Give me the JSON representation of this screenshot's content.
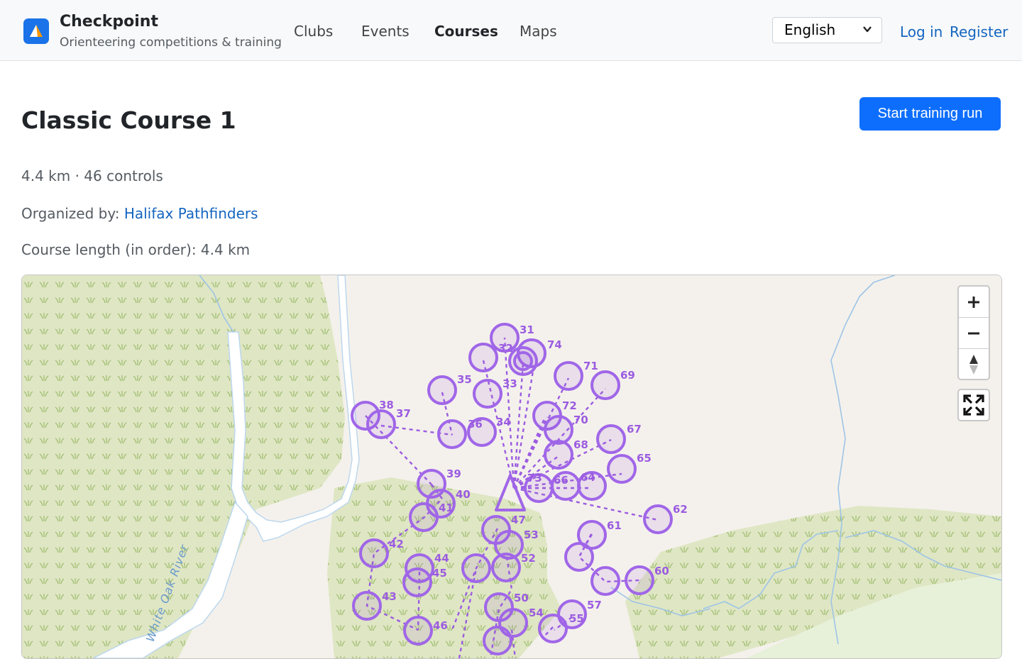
{
  "brand": {
    "name": "Checkpoint",
    "tagline": "Orienteering competitions & training"
  },
  "nav": {
    "items": [
      "Clubs",
      "Events",
      "Courses",
      "Maps"
    ],
    "active": "Courses"
  },
  "language": {
    "selected": "English"
  },
  "auth": {
    "login": "Log in",
    "register": "Register"
  },
  "course": {
    "title": "Classic Course 1",
    "stats": "4.4 km · 46 controls",
    "organized_label": "Organized by: ",
    "organizer": "Halifax Pathfinders",
    "length_text": "Course length (in order): 4.4 km"
  },
  "actions": {
    "start_training": "Start training run"
  },
  "map": {
    "river_label": "White Oak River",
    "zoom_in": "+",
    "zoom_out": "−",
    "colors": {
      "course": "#9b5ce0",
      "forest": "#dde5c2",
      "open": "#f4f1ec",
      "water": "#9ec4e6"
    },
    "controls": [
      "31",
      "32",
      "33",
      "34",
      "35",
      "36",
      "37",
      "38",
      "39",
      "40",
      "41",
      "42",
      "43",
      "44",
      "45",
      "46",
      "47",
      "50",
      "52",
      "53",
      "54",
      "55",
      "57",
      "60",
      "61",
      "62",
      "64",
      "65",
      "66",
      "67",
      "68",
      "69",
      "70",
      "71",
      "72",
      "73",
      "74"
    ]
  }
}
